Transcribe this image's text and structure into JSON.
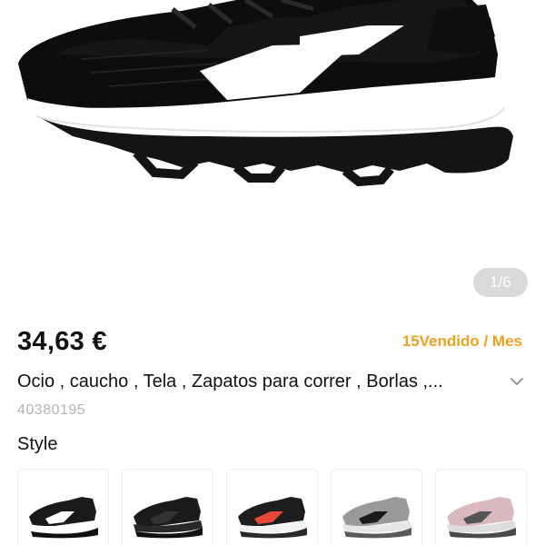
{
  "gallery": {
    "counter": "1/6"
  },
  "product": {
    "price": "34,63 €",
    "sold": "15Vendido / Mes",
    "title": "Ocio , caucho , Tela , Zapatos para correr , Borlas ,...",
    "sku": "40380195",
    "style_label": "Style"
  },
  "colors": {
    "sold_accent": "#f0a020",
    "sku_text": "#b3b3b3"
  },
  "icons": {
    "expand": "chevron-down-icon"
  },
  "variants": [
    {
      "name": "black-white",
      "upper": "#1a1a1a",
      "sole": "#ffffff",
      "accent": "#ffffff",
      "outsole": "#111111"
    },
    {
      "name": "all-black",
      "upper": "#1b1b1b",
      "sole": "#2a2a2a",
      "accent": "#333333",
      "outsole": "#111111"
    },
    {
      "name": "black-red",
      "upper": "#1e1e1e",
      "sole": "#f2f2f2",
      "accent": "#e8483a",
      "outsole": "#2a2a2a"
    },
    {
      "name": "grey-black",
      "upper": "#9a9a9a",
      "sole": "#e6e6e6",
      "accent": "#1a1a1a",
      "outsole": "#5a5a5a"
    },
    {
      "name": "pink-grey",
      "upper": "#d9b8c0",
      "sole": "#dcdcdc",
      "accent": "#555555",
      "outsole": "#4a4a4a"
    }
  ]
}
